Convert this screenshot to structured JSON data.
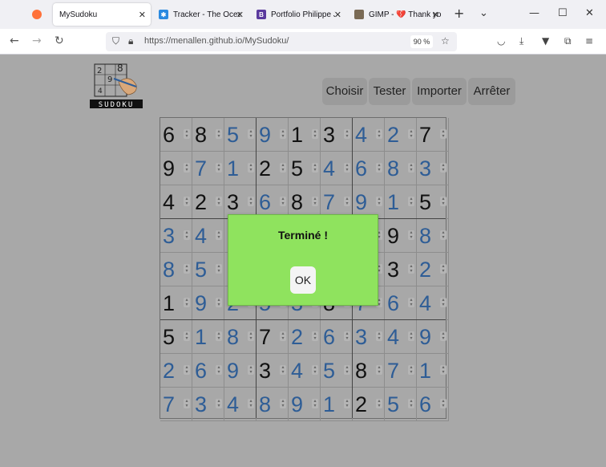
{
  "browser": {
    "tabs": [
      {
        "title": "",
        "favicon_color": "#ff7139",
        "active": false
      },
      {
        "title": "MySudoku",
        "favicon_color": "",
        "active": true
      },
      {
        "title": "Tracker - The Ocean",
        "favicon_color": "#2b8ae0",
        "active": false
      },
      {
        "title": "Portfolio Philippe J",
        "favicon_color": "#5b3a9e",
        "active": false
      },
      {
        "title": "GIMP - 💔 Thank yo",
        "favicon_color": "#7a6a55",
        "active": false
      }
    ],
    "url": "https://menallen.github.io/MySudoku/",
    "zoom": "90 %"
  },
  "app": {
    "logo_text": "SUDOKU",
    "buttons": [
      "Choisir",
      "Tester",
      "Importer",
      "Arrêter"
    ]
  },
  "grid": {
    "rows": [
      [
        [
          6,
          "g"
        ],
        [
          8,
          "g"
        ],
        [
          5,
          "u"
        ],
        [
          9,
          "u"
        ],
        [
          1,
          "g"
        ],
        [
          3,
          "g"
        ],
        [
          4,
          "u"
        ],
        [
          2,
          "u"
        ],
        [
          7,
          "g"
        ]
      ],
      [
        [
          9,
          "g"
        ],
        [
          7,
          "u"
        ],
        [
          1,
          "u"
        ],
        [
          2,
          "g"
        ],
        [
          5,
          "g"
        ],
        [
          4,
          "u"
        ],
        [
          6,
          "u"
        ],
        [
          8,
          "u"
        ],
        [
          3,
          "u"
        ]
      ],
      [
        [
          4,
          "g"
        ],
        [
          2,
          "g"
        ],
        [
          3,
          "g"
        ],
        [
          6,
          "u"
        ],
        [
          8,
          "g"
        ],
        [
          7,
          "u"
        ],
        [
          9,
          "u"
        ],
        [
          1,
          "u"
        ],
        [
          5,
          "g"
        ]
      ],
      [
        [
          3,
          "u"
        ],
        [
          4,
          "u"
        ],
        [
          null,
          ""
        ],
        [
          null,
          ""
        ],
        [
          null,
          ""
        ],
        [
          null,
          ""
        ],
        [
          null,
          ""
        ],
        [
          9,
          "g"
        ],
        [
          8,
          "u"
        ]
      ],
      [
        [
          8,
          "u"
        ],
        [
          5,
          "u"
        ],
        [
          null,
          ""
        ],
        [
          null,
          ""
        ],
        [
          null,
          ""
        ],
        [
          null,
          ""
        ],
        [
          null,
          ""
        ],
        [
          3,
          "g"
        ],
        [
          2,
          "u"
        ]
      ],
      [
        [
          1,
          "g"
        ],
        [
          9,
          "u"
        ],
        [
          2,
          "u"
        ],
        [
          5,
          "u"
        ],
        [
          3,
          "u"
        ],
        [
          8,
          "g"
        ],
        [
          7,
          "u"
        ],
        [
          6,
          "u"
        ],
        [
          4,
          "u"
        ]
      ],
      [
        [
          5,
          "g"
        ],
        [
          1,
          "u"
        ],
        [
          8,
          "u"
        ],
        [
          7,
          "g"
        ],
        [
          2,
          "u"
        ],
        [
          6,
          "u"
        ],
        [
          3,
          "u"
        ],
        [
          4,
          "u"
        ],
        [
          9,
          "u"
        ]
      ],
      [
        [
          2,
          "u"
        ],
        [
          6,
          "u"
        ],
        [
          9,
          "u"
        ],
        [
          3,
          "g"
        ],
        [
          4,
          "u"
        ],
        [
          5,
          "u"
        ],
        [
          8,
          "g"
        ],
        [
          7,
          "u"
        ],
        [
          1,
          "u"
        ]
      ],
      [
        [
          7,
          "u"
        ],
        [
          3,
          "u"
        ],
        [
          4,
          "u"
        ],
        [
          8,
          "u"
        ],
        [
          9,
          "u"
        ],
        [
          1,
          "u"
        ],
        [
          2,
          "g"
        ],
        [
          5,
          "u"
        ],
        [
          6,
          "u"
        ]
      ]
    ]
  },
  "dialog": {
    "message": "Terminé !",
    "ok_label": "OK"
  },
  "colors": {
    "given_digit": "#111111",
    "user_digit": "#2e5d96",
    "dialog_bg": "#8fe35e",
    "page_overlay": "#a8a8a8"
  }
}
